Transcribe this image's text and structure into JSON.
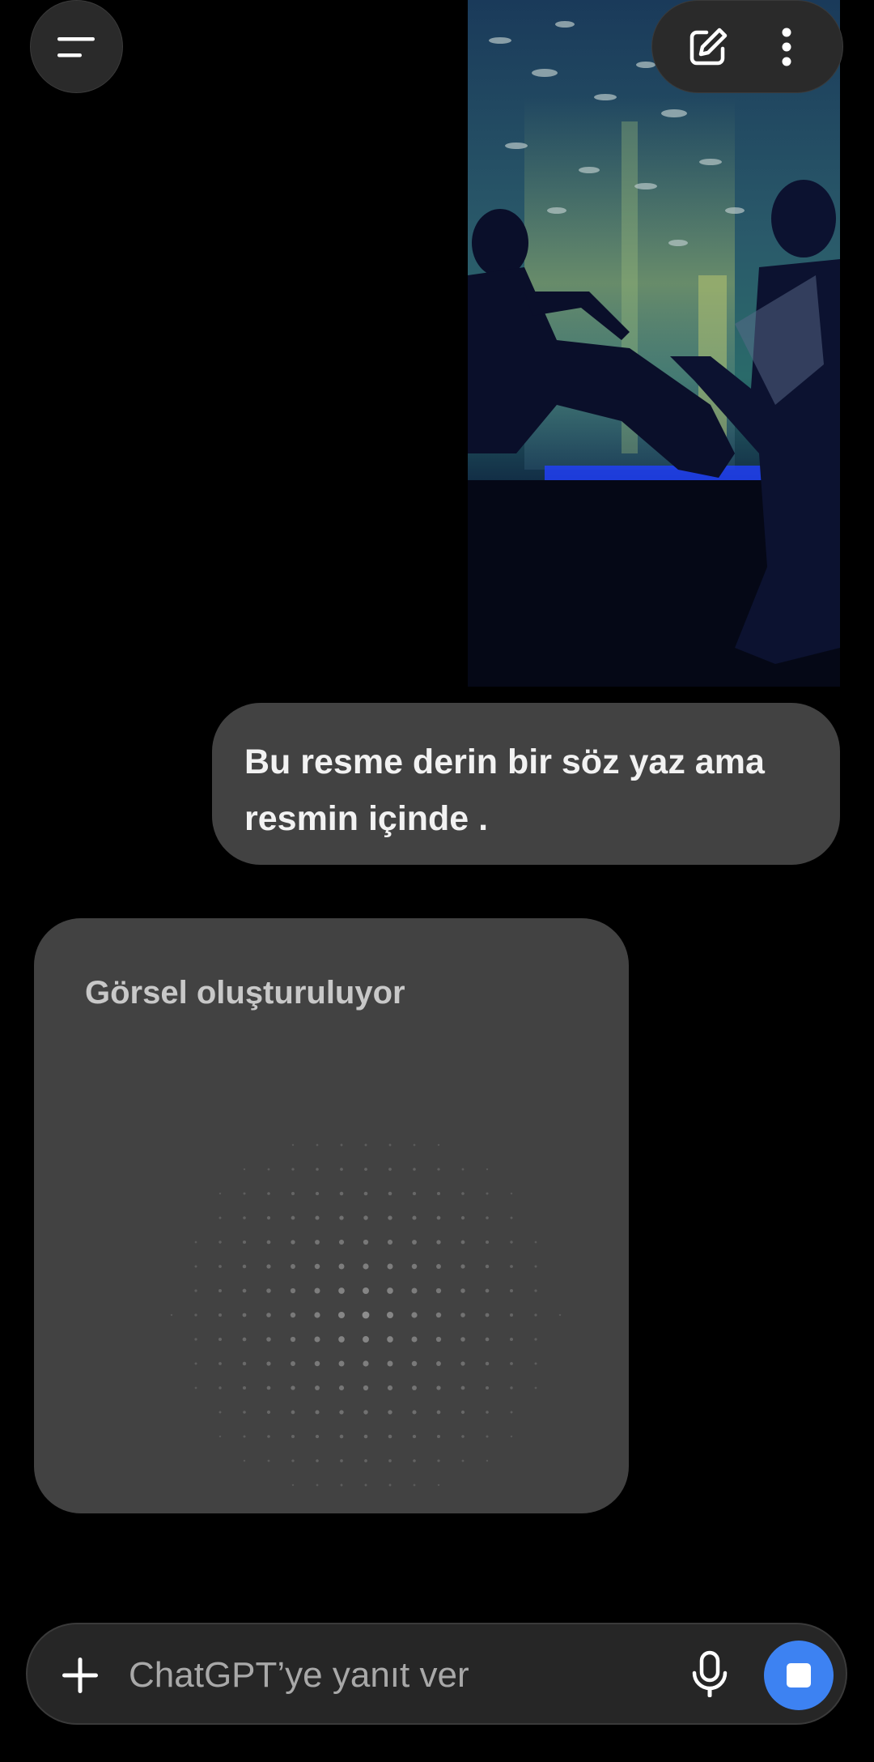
{
  "conversation": {
    "user_message": "Bu resme derin bir söz yaz ama resmin içinde .",
    "generating_label": "Görsel oluşturuluyor"
  },
  "attachment": {
    "type": "photo",
    "subject": "two-people-aquarium"
  },
  "header": {
    "menu_icon": "menu-icon",
    "new_chat_icon": "edit-icon",
    "more_icon": "more-vertical-icon"
  },
  "composer": {
    "placeholder": "ChatGPT’ye yanıt ver",
    "add_icon": "plus-icon",
    "mic_icon": "microphone-icon",
    "stop_icon": "stop-icon"
  },
  "colors": {
    "background": "#000000",
    "bubble": "#424242",
    "accent": "#3d82f2"
  }
}
